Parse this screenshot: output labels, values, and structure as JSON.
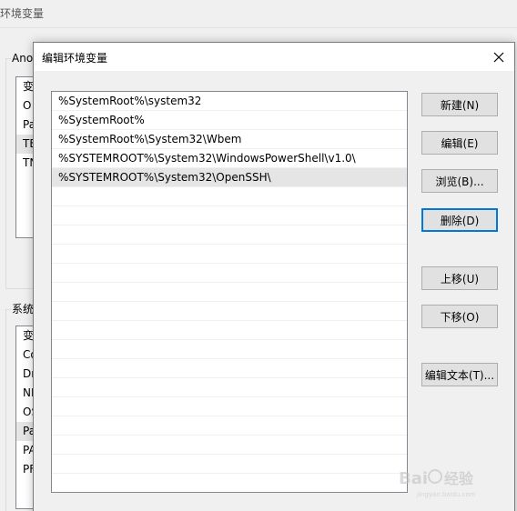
{
  "parent_window": {
    "title": "环境变量",
    "user_group_label": "Ano",
    "user_vars": [
      "变",
      "O",
      "Pa",
      "TE",
      "TN"
    ],
    "system_group_label": "系统",
    "system_vars": [
      "变",
      "Co",
      "Dr",
      "NI",
      "OS",
      "Pa",
      "PA",
      "PF"
    ]
  },
  "dialog": {
    "title": "编辑环境变量",
    "paths": [
      "%SystemRoot%\\system32",
      "%SystemRoot%",
      "%SystemRoot%\\System32\\Wbem",
      "%SYSTEMROOT%\\System32\\WindowsPowerShell\\v1.0\\",
      "%SYSTEMROOT%\\System32\\OpenSSH\\"
    ],
    "selected_index": 4,
    "buttons": {
      "new": "新建(N)",
      "edit": "编辑(E)",
      "browse": "浏览(B)...",
      "delete": "删除(D)",
      "move_up": "上移(U)",
      "move_down": "下移(O)",
      "edit_text": "编辑文本(T)..."
    }
  },
  "watermark": {
    "text": "经验",
    "subtext": "jingyan.baidu.com"
  }
}
